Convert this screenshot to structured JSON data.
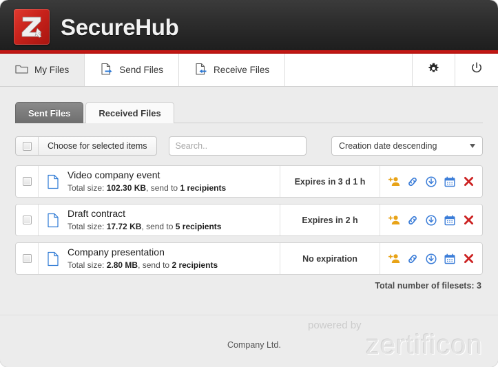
{
  "app": {
    "title": "SecureHub",
    "logo_letter": "Z",
    "logo_sub": "1",
    "brand_red": "#c8221b",
    "header_dark": "#2b2b2b"
  },
  "nav": {
    "items": [
      {
        "label": "My Files",
        "icon": "folder-icon",
        "active": true
      },
      {
        "label": "Send Files",
        "icon": "document-send-icon",
        "active": false
      },
      {
        "label": "Receive Files",
        "icon": "document-receive-icon",
        "active": false
      }
    ],
    "actions": [
      {
        "label": "Settings",
        "icon": "gear-icon"
      },
      {
        "label": "Logout",
        "icon": "power-icon"
      }
    ]
  },
  "tabs": [
    {
      "label": "Sent Files",
      "active": true
    },
    {
      "label": "Received Files",
      "active": false
    }
  ],
  "toolbar": {
    "select_all_checked": false,
    "bulk_action_label": "Choose for selected items",
    "search_value": "",
    "search_placeholder": "Search..",
    "sort_value": "Creation date descending",
    "sort_options": [
      "Creation date descending"
    ]
  },
  "filelist": {
    "rows": [
      {
        "title": "Video company event",
        "meta_prefix": "Total size: ",
        "size": "102.30 KB",
        "meta_middle": ", send to ",
        "recipients": "1 recipients",
        "expiry": "Expires in 3 d 1 h",
        "checked": false
      },
      {
        "title": "Draft contract",
        "meta_prefix": "Total size: ",
        "size": "17.72 KB",
        "meta_middle": ", send to ",
        "recipients": "5 recipients",
        "expiry": "Expires in 2 h",
        "checked": false
      },
      {
        "title": "Company presentation",
        "meta_prefix": "Total size: ",
        "size": "2.80 MB",
        "meta_middle": ", send to ",
        "recipients": "2 recipients",
        "expiry": "No expiration",
        "checked": false
      }
    ],
    "row_actions": [
      {
        "name": "add-recipient-icon",
        "color": "#e8a317"
      },
      {
        "name": "link-icon",
        "color": "#3b7dd8"
      },
      {
        "name": "download-icon",
        "color": "#3b7dd8"
      },
      {
        "name": "calendar-icon",
        "color": "#3b7dd8"
      },
      {
        "name": "delete-icon",
        "color": "#cc2222"
      }
    ],
    "total_label": "Total number of filesets: 3"
  },
  "footer": {
    "company": "Company Ltd.",
    "powered_by": "powered by",
    "vendor": "zertificon"
  }
}
